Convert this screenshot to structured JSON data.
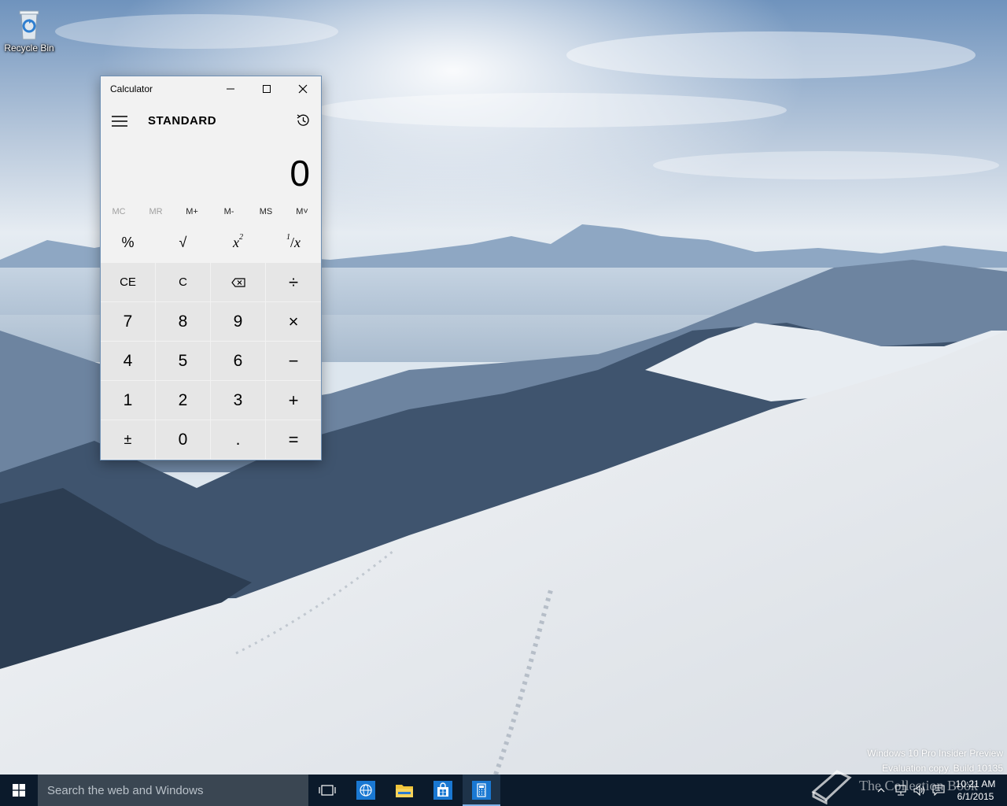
{
  "desktop": {
    "icons": [
      {
        "label": "Recycle Bin",
        "icon": "recycle-bin-icon"
      }
    ],
    "watermark_lines": [
      "Windows 10 Pro Insider Preview",
      "Evaluation copy. Build 10135"
    ],
    "brand_overlay": "The Collection Book"
  },
  "calculator": {
    "title": "Calculator",
    "mode": "STANDARD",
    "display_value": "0",
    "memory_buttons": [
      {
        "label": "MC",
        "enabled": false
      },
      {
        "label": "MR",
        "enabled": false
      },
      {
        "label": "M+",
        "enabled": true
      },
      {
        "label": "M-",
        "enabled": true
      },
      {
        "label": "MS",
        "enabled": true
      },
      {
        "label": "M˅",
        "enabled": true
      }
    ],
    "keys": {
      "percent": "%",
      "sqrt": "√",
      "square_base": "x",
      "square_exp": "2",
      "reciprocal_num": "1",
      "reciprocal_den": "x",
      "ce": "CE",
      "c": "C",
      "divide": "÷",
      "seven": "7",
      "eight": "8",
      "nine": "9",
      "multiply": "×",
      "four": "4",
      "five": "5",
      "six": "6",
      "minus": "−",
      "one": "1",
      "two": "2",
      "three": "3",
      "plus": "+",
      "negate": "±",
      "zero": "0",
      "decimal": ".",
      "equals": "="
    }
  },
  "taskbar": {
    "search_placeholder": "Search the web and Windows",
    "apps": [
      "task-view",
      "edge",
      "file-explorer",
      "store",
      "calculator"
    ],
    "clock_time": "10:21 AM",
    "clock_date": "6/1/2015",
    "accent": "#7fb2e8"
  }
}
